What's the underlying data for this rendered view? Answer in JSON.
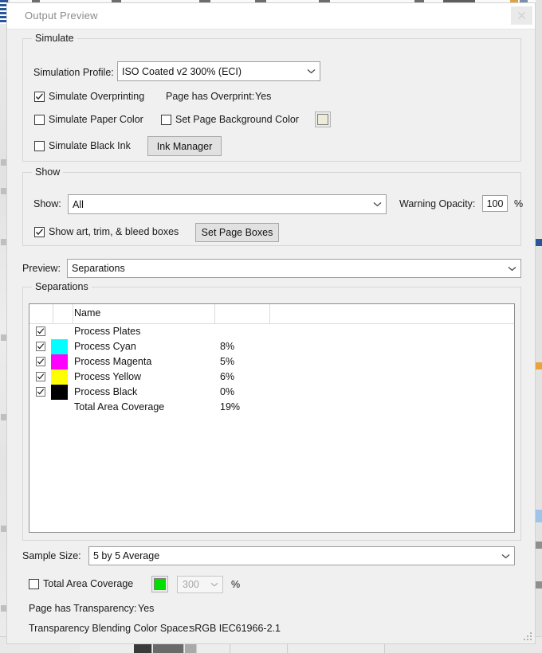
{
  "window": {
    "title": "Output Preview",
    "close_icon": "close-icon"
  },
  "simulate": {
    "group_title": "Simulate",
    "profile_label": "Simulation Profile:",
    "profile_value": "ISO Coated v2 300% (ECI)",
    "overprint_checkbox": {
      "label": "Simulate Overprinting",
      "checked": true
    },
    "page_has_overprint_label": "Page has Overprint:",
    "page_has_overprint_value": "Yes",
    "paper_color_checkbox": {
      "label": "Simulate Paper Color",
      "checked": false
    },
    "set_page_bg_checkbox": {
      "label": "Set Page Background Color",
      "checked": false
    },
    "page_bg_swatch_color": "#ececd8",
    "black_ink_checkbox": {
      "label": "Simulate Black Ink",
      "checked": false
    },
    "ink_manager_button": "Ink Manager"
  },
  "show": {
    "group_title": "Show",
    "show_label": "Show:",
    "show_value": "All",
    "warning_opacity_label": "Warning Opacity:",
    "warning_opacity_value": "100",
    "warning_opacity_unit": "%",
    "boxes_checkbox": {
      "label": "Show art, trim, & bleed boxes",
      "checked": true
    },
    "set_page_boxes_button": "Set Page Boxes"
  },
  "preview": {
    "label": "Preview:",
    "value": "Separations"
  },
  "separations": {
    "group_title": "Separations",
    "columns": [
      "",
      "",
      "Name",
      "",
      ""
    ],
    "rows": [
      {
        "checked": true,
        "swatch": null,
        "name": "Process Plates",
        "percent": ""
      },
      {
        "checked": true,
        "swatch": "#00ffff",
        "name": "Process Cyan",
        "percent": "8%"
      },
      {
        "checked": true,
        "swatch": "#ff00ff",
        "name": "Process Magenta",
        "percent": "5%"
      },
      {
        "checked": true,
        "swatch": "#ffff00",
        "name": "Process Yellow",
        "percent": "6%"
      },
      {
        "checked": true,
        "swatch": "#000000",
        "name": "Process Black",
        "percent": "0%"
      },
      {
        "checked": null,
        "swatch": null,
        "name": "Total Area Coverage",
        "percent": "19%"
      }
    ]
  },
  "footer": {
    "sample_size_label": "Sample Size:",
    "sample_size_value": "5 by 5 Average",
    "tac_checkbox": {
      "label": "Total Area Coverage",
      "checked": false
    },
    "tac_swatch_color": "#00e000",
    "tac_value": "300",
    "tac_unit": "%",
    "transparency_label": "Page has Transparency:",
    "transparency_value": "Yes",
    "blending_label": "Transparency Blending Color Space:",
    "blending_value": "sRGB IEC61966-2.1"
  }
}
